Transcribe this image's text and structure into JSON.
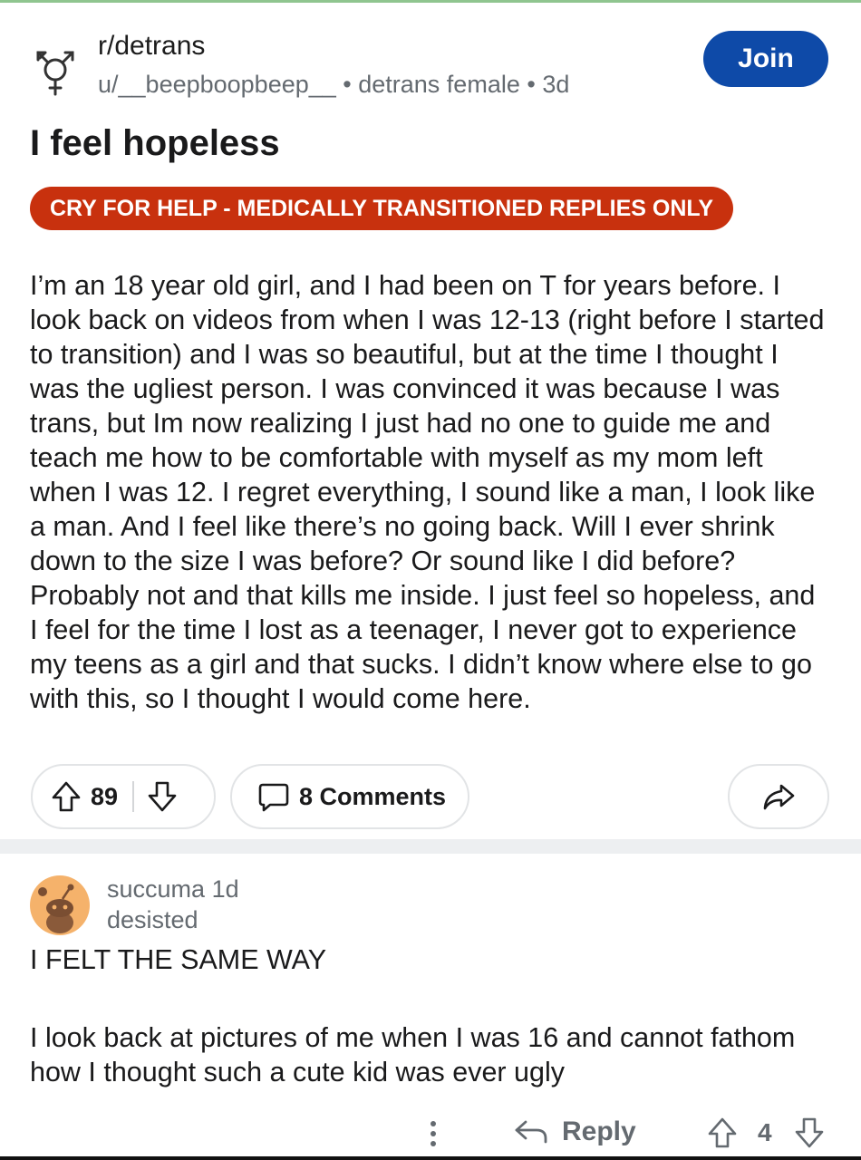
{
  "post": {
    "subreddit": "r/detrans",
    "author": "u/__beepboopbeep__",
    "author_flair": "detrans female",
    "age": "3d",
    "meta_sep": " • ",
    "join_label": "Join",
    "title": "I feel hopeless",
    "flair": "CRY FOR HELP - MEDICALLY TRANSITIONED REPLIES ONLY",
    "flair_color": "#c8310e",
    "body": "I’m an 18 year old girl, and I had been on T for years before. I look back on videos from when I was 12-13 (right before I started to transition) and I was so beautiful, but at the time I thought I was the ugliest person. I was convinced it was because I was trans, but Im now realizing I just had no one to guide me and teach me how to be comfortable with myself as my mom left when I was 12. I regret everything, I sound like a man, I look like a man. And I feel like there’s no going back. Will I ever shrink down to the size I was before? Or sound like I did before? Probably not and that kills me inside. I just feel so hopeless, and I feel for the time I lost as a teenager, I never got to experience my teens as a girl and that sucks. I didn’t know where else to go with this, so I thought I would come here.",
    "votes": "89",
    "comments_label": "8 Comments"
  },
  "comment": {
    "username": "succuma",
    "age": "1d",
    "flair": "desisted",
    "paragraph1": "I FELT THE SAME WAY",
    "paragraph2": "I look back at pictures of me when I was 16 and cannot fathom how I thought such a cute kid was ever ugly",
    "reply_label": "Reply",
    "votes": "4"
  },
  "icons": {
    "subreddit": "transgender-symbol-icon",
    "upvote": "upvote-arrow-icon",
    "downvote": "downvote-arrow-icon",
    "comments": "speech-bubble-icon",
    "share": "share-arrow-icon",
    "more": "vertical-dots-icon",
    "reply": "reply-arrow-icon"
  },
  "colors": {
    "join_button": "#0e4aa8",
    "muted_text": "#646a70",
    "text": "#1a1a1b",
    "avatar_bg": "#f5b26b"
  }
}
